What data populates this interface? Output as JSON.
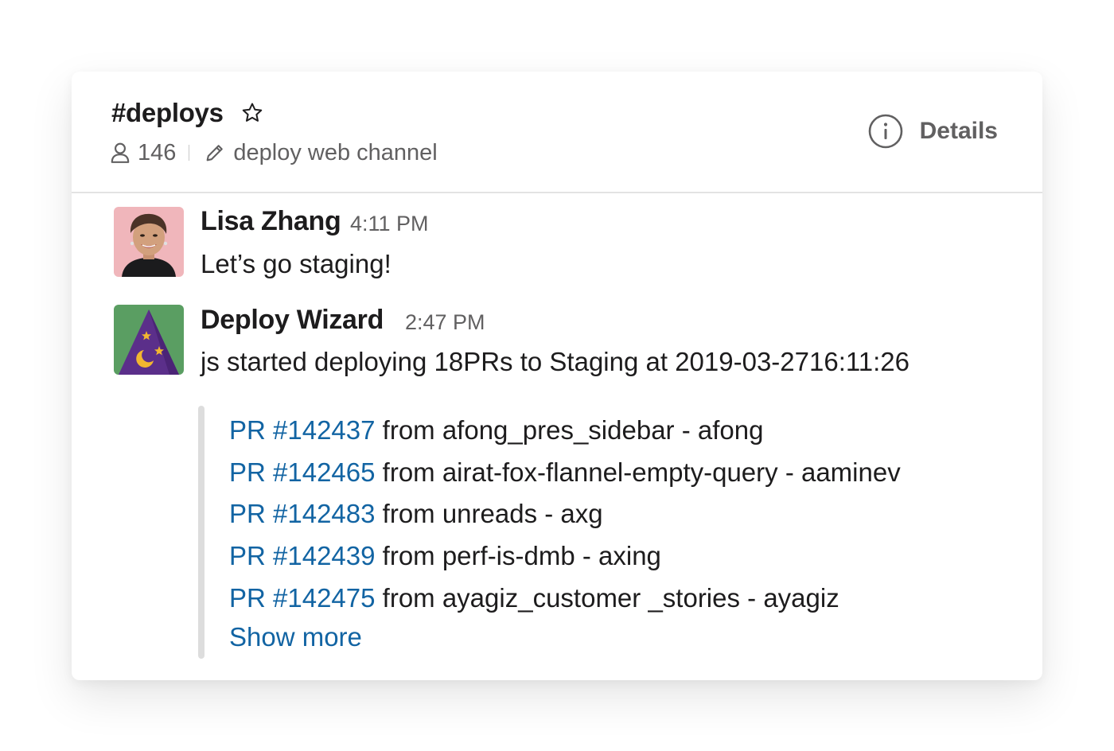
{
  "channel": {
    "name": "#deploys",
    "member_count": "146",
    "topic": "deploy web channel",
    "details_label": "Details"
  },
  "messages": [
    {
      "author": "Lisa Zhang",
      "time": "4:11 PM",
      "text": "Let’s go staging!"
    },
    {
      "author": "Deploy Wizard",
      "time": "2:47 PM",
      "text": "js started deploying 18PRs to Staging at 2019-03-2716:11:26",
      "attachment": {
        "items": [
          {
            "pr": "PR #142437",
            "detail": "from afong_pres_sidebar - afong"
          },
          {
            "pr": "PR #142465",
            "detail": "from airat-fox-flannel-empty-query - aaminev"
          },
          {
            "pr": "PR #142483",
            "detail": "from unreads - axg"
          },
          {
            "pr": "PR #142439",
            "detail": "from perf-is-dmb - axing"
          },
          {
            "pr": "PR #142475",
            "detail": "from ayagiz_customer _stories - ayagiz"
          }
        ],
        "show_more": "Show more"
      }
    }
  ],
  "colors": {
    "link": "#1264a3",
    "text": "#1d1c1d",
    "muted": "#616061",
    "wizard_bg": "#5a9e62",
    "wizard_hat": "#5b2f8a"
  }
}
